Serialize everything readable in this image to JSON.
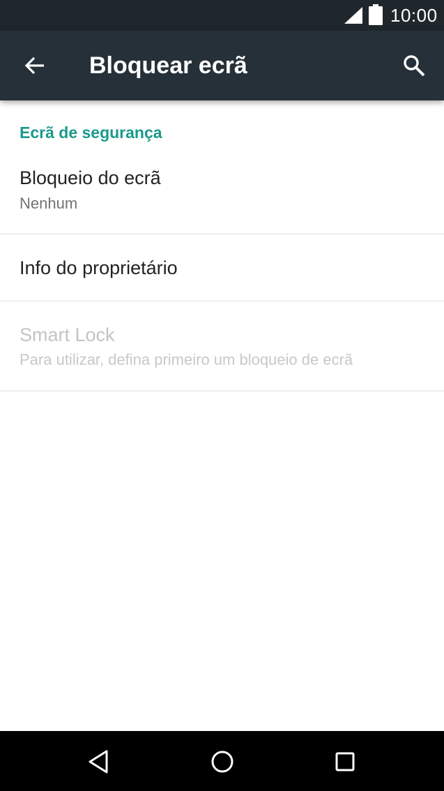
{
  "status_bar": {
    "time": "10:00",
    "icons": [
      "signal-icon",
      "battery-icon"
    ]
  },
  "app_bar": {
    "title": "Bloquear ecrã",
    "back_icon": "arrow-back-icon",
    "search_icon": "search-icon"
  },
  "section": {
    "header": "Ecrã de segurança"
  },
  "items": [
    {
      "title": "Bloqueio do ecrã",
      "summary": "Nenhum",
      "enabled": true
    },
    {
      "title": "Info do proprietário",
      "summary": "",
      "enabled": true
    },
    {
      "title": "Smart Lock",
      "summary": "Para utilizar, defina primeiro um bloqueio de ecrã",
      "enabled": false
    }
  ],
  "nav_bar": {
    "icons": [
      "back-triangle-icon",
      "home-circle-icon",
      "recents-square-icon"
    ]
  },
  "colors": {
    "status_bar_bg": "#1f272c",
    "app_bar_bg": "#263038",
    "accent": "#1a9a8c",
    "disabled_text": "#c4c4c4"
  }
}
